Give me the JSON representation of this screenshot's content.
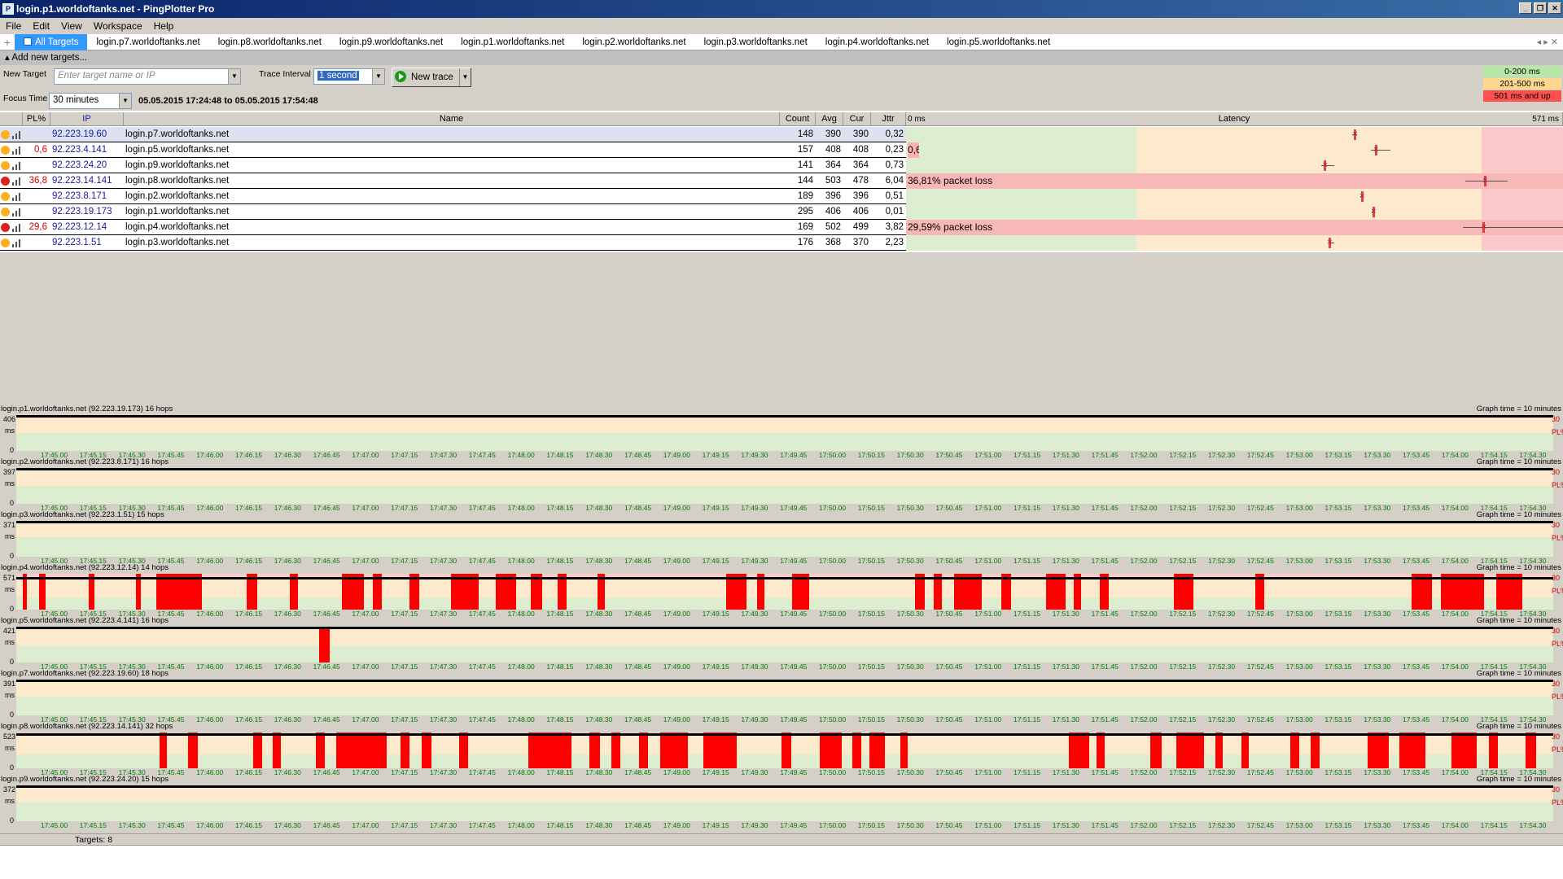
{
  "window": {
    "title": "login.p1.worldoftanks.net - PingPlotter Pro",
    "app_icon": "pingplotter-icon"
  },
  "menu": [
    "File",
    "Edit",
    "View",
    "Workspace",
    "Help"
  ],
  "tabs": [
    "All Targets",
    "login.p7.worldoftanks.net",
    "login.p8.worldoftanks.net",
    "login.p9.worldoftanks.net",
    "login.p1.worldoftanks.net",
    "login.p2.worldoftanks.net",
    "login.p3.worldoftanks.net",
    "login.p4.worldoftanks.net",
    "login.p5.worldoftanks.net"
  ],
  "add_targets": "Add new targets...",
  "new_target": {
    "label": "New Target",
    "placeholder": "Enter target name or IP"
  },
  "trace_interval": {
    "label": "Trace Interval",
    "value": "1 second"
  },
  "new_trace_button": "New trace",
  "focus_time": {
    "label": "Focus Time",
    "value": "30 minutes",
    "range": "05.05.2015 17:24:48 to 05.05.2015 17:54:48"
  },
  "legend": [
    {
      "label": "0-200 ms",
      "color": "#b8e8a8"
    },
    {
      "label": "201-500 ms",
      "color": "#ffd890"
    },
    {
      "label": "501 ms and up",
      "color": "#ff5050"
    }
  ],
  "columns": {
    "pl": "PL%",
    "ip": "IP",
    "name": "Name",
    "count": "Count",
    "avg": "Avg",
    "cur": "Cur",
    "jitter": "Jttr",
    "latency": "Latency",
    "lat_min": "0 ms",
    "lat_max": "571 ms"
  },
  "latency_scale_max": 571,
  "rows": [
    {
      "status": "yellow",
      "pl": "",
      "ip": "92.223.19.60",
      "name": "login.p7.worldoftanks.net",
      "count": "148",
      "avg": "390",
      "cur": "390",
      "jitter": "0,32",
      "loss_msg": "",
      "avg_ms": 390,
      "min_ms": 388,
      "max_ms": 392
    },
    {
      "status": "yellow",
      "pl": "0,6",
      "ip": "92.223.4.141",
      "name": "login.p5.worldoftanks.net",
      "count": "157",
      "avg": "408",
      "cur": "408",
      "jitter": "0,23",
      "loss_msg": "0,6",
      "avg_ms": 408,
      "min_ms": 404,
      "max_ms": 421
    },
    {
      "status": "yellow",
      "pl": "",
      "ip": "92.223.24.20",
      "name": "login.p9.worldoftanks.net",
      "count": "141",
      "avg": "364",
      "cur": "364",
      "jitter": "0,73",
      "loss_msg": "",
      "avg_ms": 364,
      "min_ms": 361,
      "max_ms": 372
    },
    {
      "status": "red",
      "pl": "36,8",
      "ip": "92.223.14.141",
      "name": "login.p8.worldoftanks.net",
      "count": "144",
      "avg": "503",
      "cur": "478",
      "jitter": "6,04",
      "loss_msg": "36,81% packet loss",
      "avg_ms": 503,
      "min_ms": 486,
      "max_ms": 523
    },
    {
      "status": "yellow",
      "pl": "",
      "ip": "92.223.8.171",
      "name": "login.p2.worldoftanks.net",
      "count": "189",
      "avg": "396",
      "cur": "396",
      "jitter": "0,51",
      "loss_msg": "",
      "avg_ms": 396,
      "min_ms": 395,
      "max_ms": 397
    },
    {
      "status": "yellow",
      "pl": "",
      "ip": "92.223.19.173",
      "name": "login.p1.worldoftanks.net",
      "count": "295",
      "avg": "406",
      "cur": "406",
      "jitter": "0,01",
      "loss_msg": "",
      "avg_ms": 406,
      "min_ms": 405,
      "max_ms": 406
    },
    {
      "status": "red",
      "pl": "29,6",
      "ip": "92.223.12.14",
      "name": "login.p4.worldoftanks.net",
      "count": "169",
      "avg": "502",
      "cur": "499",
      "jitter": "3,82",
      "loss_msg": "29,59% packet loss",
      "avg_ms": 502,
      "min_ms": 484,
      "max_ms": 571
    },
    {
      "status": "yellow",
      "pl": "",
      "ip": "92.223.1.51",
      "name": "login.p3.worldoftanks.net",
      "count": "176",
      "avg": "368",
      "cur": "370",
      "jitter": "2,23",
      "loss_msg": "",
      "avg_ms": 368,
      "min_ms": 367,
      "max_ms": 372
    }
  ],
  "graph_time": "Graph time = 10 minutes",
  "ms_label": "ms",
  "pl_label": "PL%",
  "pl_max": "30",
  "y_min": "0",
  "time_ticks": [
    "17:45.00",
    "17:45.15",
    "17:45.30",
    "17:45.45",
    "17:46.00",
    "17:46.15",
    "17:46.30",
    "17:46.45",
    "17:47.00",
    "17:47.15",
    "17:47.30",
    "17:47.45",
    "17:48.00",
    "17:48.15",
    "17:48.30",
    "17:48.45",
    "17:49.00",
    "17:49.15",
    "17:49.30",
    "17:49.45",
    "17:50.00",
    "17:50.15",
    "17:50.30",
    "17:50.45",
    "17:51.00",
    "17:51.15",
    "17:51.30",
    "17:51.45",
    "17:52.00",
    "17:52.15",
    "17:52.30",
    "17:52.45",
    "17:53.00",
    "17:53.15",
    "17:53.30",
    "17:53.45",
    "17:54.00",
    "17:54.15",
    "17:54.30"
  ],
  "graphs": [
    {
      "title": "login.p1.worldoftanks.net (92.223.19.173) 16 hops",
      "ymax": "406",
      "ymax_ms": 406,
      "latency_ms": 406,
      "loss_fractions": []
    },
    {
      "title": "login.p2.worldoftanks.net (92.223.8.171) 16 hops",
      "ymax": "397",
      "ymax_ms": 397,
      "latency_ms": 396,
      "loss_fractions": []
    },
    {
      "title": "login.p3.worldoftanks.net (92.223.1.51) 15 hops",
      "ymax": "371",
      "ymax_ms": 371,
      "latency_ms": 368,
      "loss_fractions": []
    },
    {
      "title": "login.p4.worldoftanks.net (92.223.12.14) 14 hops",
      "ymax": "571",
      "ymax_ms": 571,
      "latency_ms": 502,
      "loss_fractions": [
        [
          0.004,
          0.007
        ],
        [
          0.015,
          0.019
        ],
        [
          0.047,
          0.051
        ],
        [
          0.078,
          0.081
        ],
        [
          0.091,
          0.121
        ],
        [
          0.15,
          0.157
        ],
        [
          0.178,
          0.183
        ],
        [
          0.212,
          0.226
        ],
        [
          0.232,
          0.238
        ],
        [
          0.256,
          0.262
        ],
        [
          0.283,
          0.301
        ],
        [
          0.312,
          0.325
        ],
        [
          0.335,
          0.342
        ],
        [
          0.352,
          0.358
        ],
        [
          0.378,
          0.383
        ],
        [
          0.462,
          0.475
        ],
        [
          0.482,
          0.487
        ],
        [
          0.505,
          0.516
        ],
        [
          0.585,
          0.591
        ],
        [
          0.597,
          0.602
        ],
        [
          0.61,
          0.628
        ],
        [
          0.641,
          0.647
        ],
        [
          0.67,
          0.683
        ],
        [
          0.688,
          0.693
        ],
        [
          0.705,
          0.711
        ],
        [
          0.753,
          0.766
        ],
        [
          0.806,
          0.812
        ],
        [
          0.908,
          0.921
        ],
        [
          0.927,
          0.955
        ],
        [
          0.963,
          0.98
        ]
      ]
    },
    {
      "title": "login.p5.worldoftanks.net (92.223.4.141) 16 hops",
      "ymax": "421",
      "ymax_ms": 421,
      "latency_ms": 408,
      "loss_fractions": [
        [
          0.197,
          0.204
        ]
      ]
    },
    {
      "title": "login.p7.worldoftanks.net (92.223.19.60) 18 hops",
      "ymax": "391",
      "ymax_ms": 391,
      "latency_ms": 390,
      "loss_fractions": []
    },
    {
      "title": "login.p8.worldoftanks.net (92.223.14.141) 32 hops",
      "ymax": "523",
      "ymax_ms": 523,
      "latency_ms": 503,
      "loss_fractions": [
        [
          0.093,
          0.098
        ],
        [
          0.112,
          0.118
        ],
        [
          0.154,
          0.16
        ],
        [
          0.167,
          0.172
        ],
        [
          0.195,
          0.201
        ],
        [
          0.208,
          0.241
        ],
        [
          0.25,
          0.256
        ],
        [
          0.264,
          0.27
        ],
        [
          0.288,
          0.294
        ],
        [
          0.333,
          0.361
        ],
        [
          0.373,
          0.38
        ],
        [
          0.387,
          0.393
        ],
        [
          0.405,
          0.411
        ],
        [
          0.419,
          0.437
        ],
        [
          0.447,
          0.469
        ],
        [
          0.498,
          0.504
        ],
        [
          0.523,
          0.537
        ],
        [
          0.544,
          0.55
        ],
        [
          0.555,
          0.565
        ],
        [
          0.575,
          0.58
        ],
        [
          0.685,
          0.698
        ],
        [
          0.703,
          0.708
        ],
        [
          0.738,
          0.745
        ],
        [
          0.755,
          0.773
        ],
        [
          0.78,
          0.785
        ],
        [
          0.797,
          0.802
        ],
        [
          0.829,
          0.835
        ],
        [
          0.842,
          0.848
        ],
        [
          0.879,
          0.893
        ],
        [
          0.9,
          0.917
        ],
        [
          0.934,
          0.95
        ],
        [
          0.958,
          0.964
        ],
        [
          0.982,
          0.989
        ]
      ]
    },
    {
      "title": "login.p9.worldoftanks.net (92.223.24.20) 15 hops",
      "ymax": "372",
      "ymax_ms": 372,
      "latency_ms": 364,
      "loss_fractions": []
    }
  ],
  "status_bar": "Targets: 8"
}
